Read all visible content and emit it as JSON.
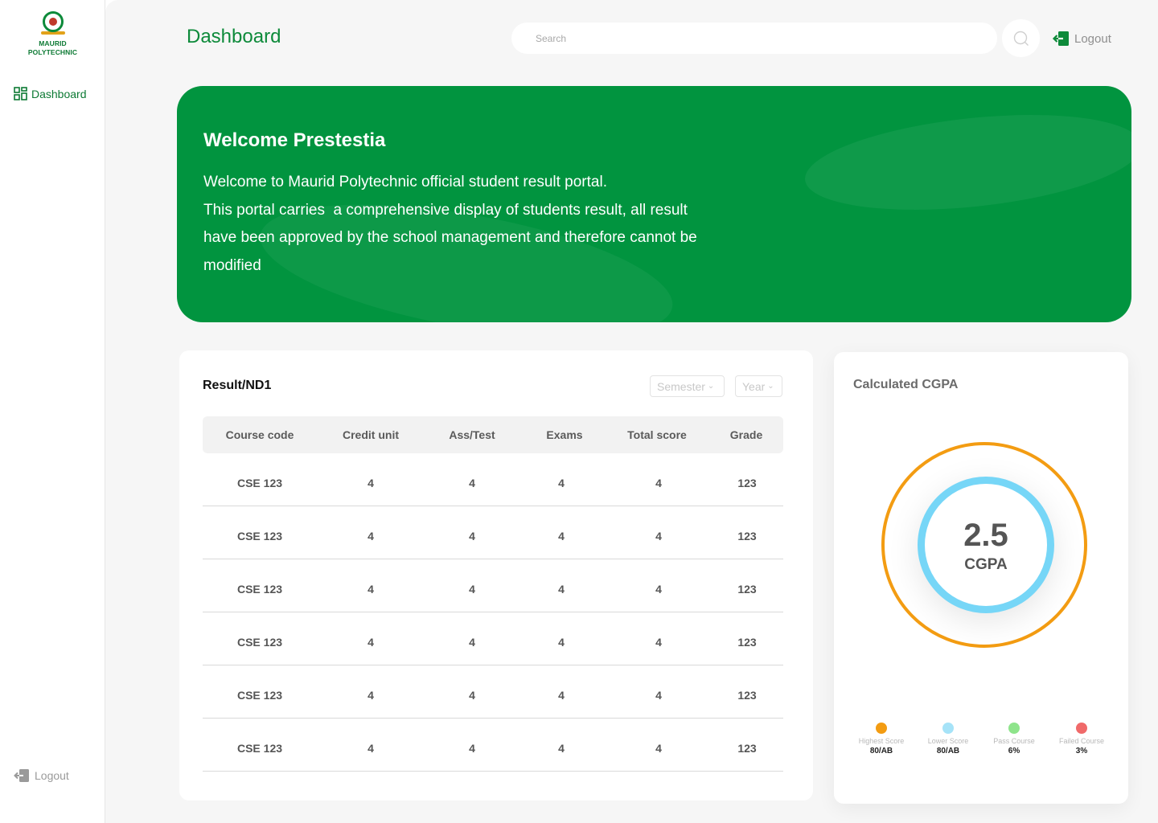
{
  "brand": {
    "line1": "MAURID",
    "line2": "POLYTECHNIC"
  },
  "sidebar": {
    "nav": [
      {
        "label": "Dashboard",
        "icon": "dashboard-grid-icon"
      }
    ],
    "logout_label": "Logout"
  },
  "header": {
    "title": "Dashboard",
    "search_placeholder": "Search",
    "logout_label": "Logout"
  },
  "banner": {
    "title": "Welcome Prestestia",
    "lines": [
      "Welcome to Maurid Polytechnic official student result portal.",
      "This portal carries  a comprehensive display of students result, all result",
      "have been approved by the school management and therefore cannot be",
      "modified"
    ]
  },
  "result": {
    "title": "Result/ND1",
    "semester_select": "Semester",
    "year_select": "Year",
    "columns": [
      "Course code",
      "Credit unit",
      "Ass/Test",
      "Exams",
      "Total score",
      "Grade"
    ],
    "rows": [
      [
        "CSE 123",
        "4",
        "4",
        "4",
        "4",
        "123"
      ],
      [
        "CSE 123",
        "4",
        "4",
        "4",
        "4",
        "123"
      ],
      [
        "CSE 123",
        "4",
        "4",
        "4",
        "4",
        "123"
      ],
      [
        "CSE 123",
        "4",
        "4",
        "4",
        "4",
        "123"
      ],
      [
        "CSE 123",
        "4",
        "4",
        "4",
        "4",
        "123"
      ],
      [
        "CSE 123",
        "4",
        "4",
        "4",
        "4",
        "123"
      ]
    ]
  },
  "cgpa": {
    "title": "Calculated CGPA",
    "value": "2.5",
    "label": "CGPA",
    "legend": [
      {
        "label": "Highest Score",
        "value": "80/AB",
        "color": "#f39c12"
      },
      {
        "label": "Lower Score",
        "value": "80/AB",
        "color": "#a6e3f8"
      },
      {
        "label": "Pass Course",
        "value": "6%",
        "color": "#8ee48b"
      },
      {
        "label": "Failed Course",
        "value": "3%",
        "color": "#f06a6a"
      }
    ]
  },
  "colors": {
    "brand_green": "#01943f",
    "accent_orange": "#f39c12",
    "accent_blue": "#76d6f7"
  }
}
